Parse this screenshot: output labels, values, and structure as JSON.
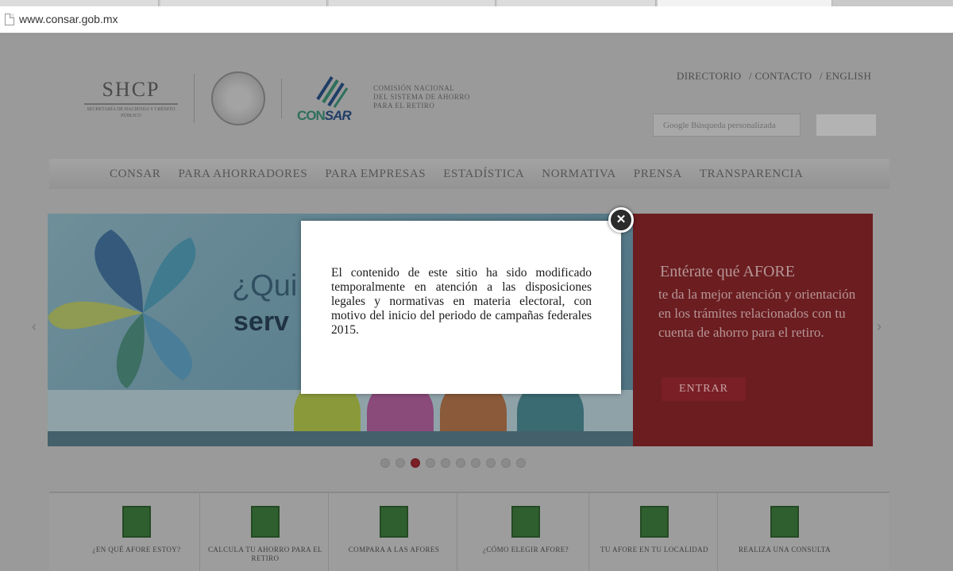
{
  "browser": {
    "url": "www.consar.gob.mx"
  },
  "header": {
    "shcp_title": "SHCP",
    "shcp_subtitle": "SECRETARÍA DE HACIENDA Y CRÉDITO PÚBLICO",
    "consar_logo_text_a": "CON",
    "consar_logo_text_b": "SAR",
    "comision_line1": "COMISIÓN NACIONAL",
    "comision_line2": "DEL SISTEMA DE AHORRO",
    "comision_line3": "PARA EL RETIRO",
    "links": [
      "DIRECTORIO",
      "/ CONTACTO",
      "/ ENGLISH"
    ],
    "search_placeholder": "Google Búsqueda personalizada"
  },
  "nav": [
    "CONSAR",
    "PARA AHORRADORES",
    "PARA EMPRESAS",
    "ESTADÍSTICA",
    "NORMATIVA",
    "PRENSA",
    "TRANSPARENCIA"
  ],
  "hero": {
    "headline_line1": "¿Qui",
    "headline_line2": "serv"
  },
  "promo": {
    "title": "Entérate qué AFORE",
    "text": "te da la mejor atención y orientación en los trámites relacionados con tu cuenta de ahorro para el retiro.",
    "button": "ENTRAR"
  },
  "carousel": {
    "total_dots": 10,
    "active_index": 2
  },
  "services": [
    {
      "label": "¿EN QUÉ AFORE ESTOY?",
      "icon": "question-icon"
    },
    {
      "label": "CALCULA TU AHORRO PARA EL RETIRO",
      "icon": "calculator-icon"
    },
    {
      "label": "COMPARA A LAS AFORES",
      "icon": "balance-icon"
    },
    {
      "label": "¿CÓMO ELEGIR AFORE?",
      "icon": "pyramid-icon"
    },
    {
      "label": "TU AFORE EN TU LOCALIDAD",
      "icon": "map-pin-icon"
    },
    {
      "label": "REALIZA UNA CONSULTA",
      "icon": "info-icon"
    }
  ],
  "modal": {
    "text": "El contenido de este sitio ha sido modificado temporalmente en atención a las disposiciones legales y normativas en materia electoral, con motivo del inicio del periodo de campañas federales 2015.",
    "close_label": "✕"
  },
  "colors": {
    "promo_red": "#8e2a30",
    "service_green": "#3a7a3a",
    "active_dot": "#a32a35"
  }
}
